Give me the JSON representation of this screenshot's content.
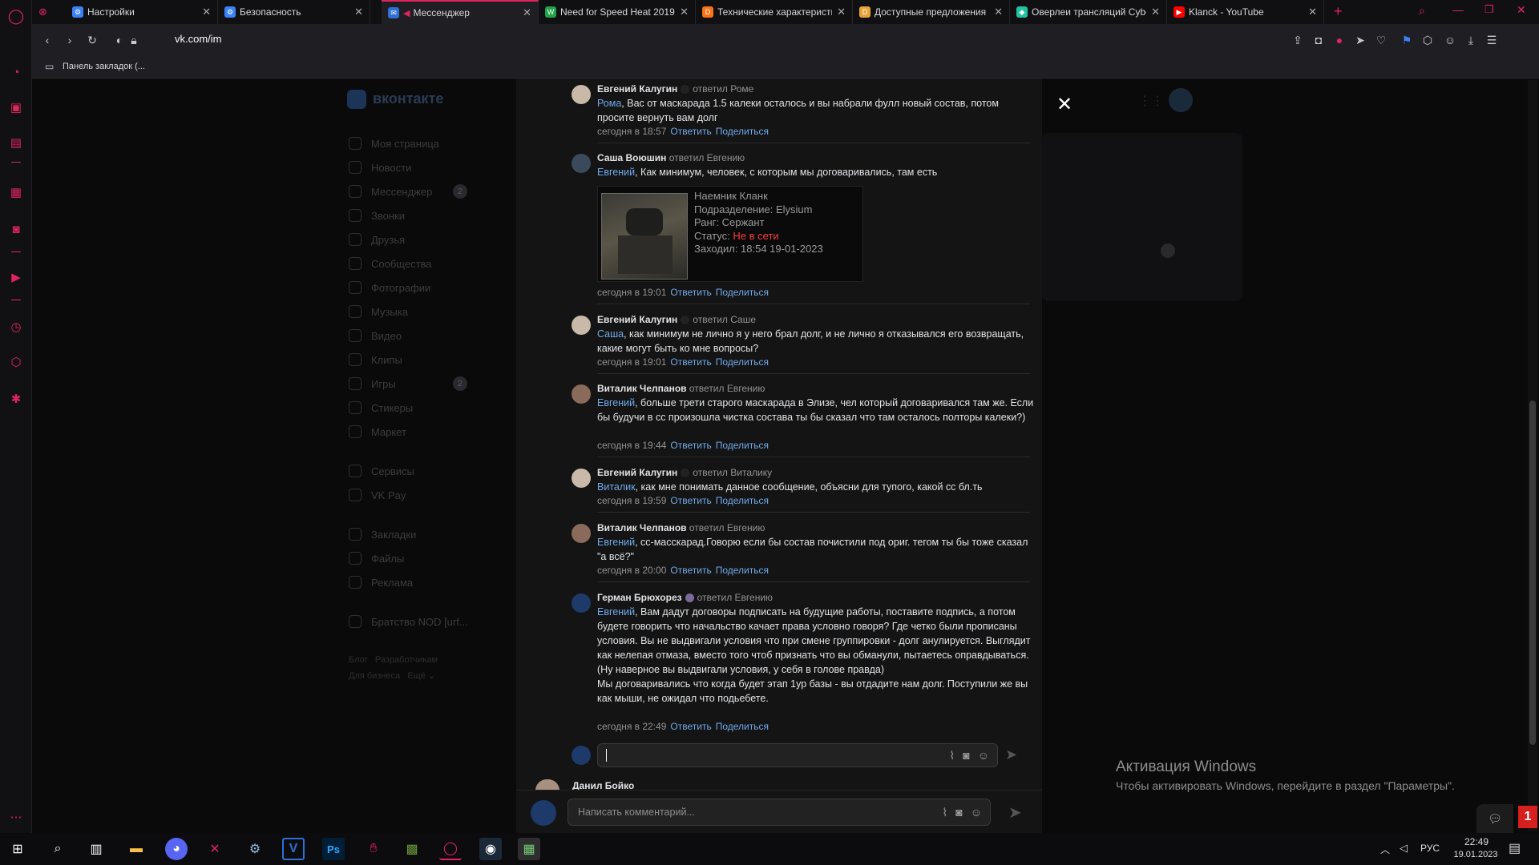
{
  "browser": {
    "tabs": [
      {
        "title": "Настройки",
        "icon_color": "#3b82f6",
        "active": false
      },
      {
        "title": "Безопасность",
        "icon_color": "#3b82f6",
        "active": false
      },
      {
        "title": "Мессенджер",
        "icon_color": "#2f6fd6",
        "active": true
      },
      {
        "title": "Need for Speed Heat 2019",
        "icon_color": "#22a34a",
        "active": false
      },
      {
        "title": "Технические характеристи",
        "icon_color": "#f97316",
        "active": false
      },
      {
        "title": "Доступные предложения",
        "icon_color": "#e8a23a",
        "active": false
      },
      {
        "title": "Оверлеи трансляций Cybe",
        "icon_color": "#22c3a0",
        "active": false
      },
      {
        "title": "Klanck - YouTube",
        "icon_color": "#ff0000",
        "active": false
      }
    ],
    "url": "vk.com/im",
    "bookmark_folder": "Панель закладок (..."
  },
  "vk": {
    "logo": "вконтакте",
    "menu": [
      {
        "label": "Моя страница",
        "count": ""
      },
      {
        "label": "Новости",
        "count": ""
      },
      {
        "label": "Мессенджер",
        "count": "2"
      },
      {
        "label": "Звонки",
        "count": ""
      },
      {
        "label": "Друзья",
        "count": ""
      },
      {
        "label": "Сообщества",
        "count": ""
      },
      {
        "label": "Фотографии",
        "count": ""
      },
      {
        "label": "Музыка",
        "count": ""
      },
      {
        "label": "Видео",
        "count": ""
      },
      {
        "label": "Клипы",
        "count": ""
      },
      {
        "label": "Игры",
        "count": "2"
      },
      {
        "label": "Стикеры",
        "count": ""
      },
      {
        "label": "Маркет",
        "count": ""
      }
    ],
    "menu2": [
      {
        "label": "Сервисы"
      },
      {
        "label": "VK Pay"
      }
    ],
    "menu3": [
      {
        "label": "Закладки"
      },
      {
        "label": "Файлы"
      },
      {
        "label": "Реклама"
      }
    ],
    "community": "Братство NOD [urf...",
    "footer1": "Блог   Разработчикам",
    "footer2": "Для бизнеса   Ещё ⌄"
  },
  "comments": [
    {
      "author": "Евгений Калугин",
      "replied": "ответил Роме",
      "mention": "Рома",
      "text": ", Вас от маскарада 1.5 калеки осталось и вы набрали фулл новый состав, потом просите вернуть вам долг",
      "time": "сегодня в 18:57"
    },
    {
      "author": "Саша Воюшин",
      "replied": "ответил Евгению",
      "mention": "Евгений",
      "text": ", Как минимум, человек, с которым мы договаривались, там есть",
      "time": "сегодня в 19:01"
    },
    {
      "author": "Евгений Калугин",
      "replied": "ответил Саше",
      "mention": "Саша",
      "text": ", как минимум не лично я у него брал долг, и не лично я отказывался его возвращать, какие могут быть ко мне вопросы?",
      "time": "сегодня в 19:01"
    },
    {
      "author": "Виталик Челпанов",
      "replied": "ответил Евгению",
      "mention": "Евгений",
      "text": ", больше трети старого маскарада в Элизе, чел который договаривался там же. Если бы будучи в сс произошла чистка состава ты бы сказал что там осталось полторы калеки?)",
      "time": "сегодня в 19:44"
    },
    {
      "author": "Евгений Калугин",
      "replied": "ответил Виталику",
      "mention": "Виталик",
      "text": ", как мне понимать данное сообщение, объясни для тупого, какой сс бл.ть",
      "time": "сегодня в 19:59"
    },
    {
      "author": "Виталик Челпанов",
      "replied": "ответил Евгению",
      "mention": "Евгений",
      "text": ", сс-масскарад.Говорю если бы состав почистили под ориг. тегом ты бы тоже сказал \"а всё?\"",
      "time": "сегодня в 20:00"
    },
    {
      "author": "Герман Брюхорез",
      "replied": "ответил Евгению",
      "mention": "Евгений",
      "text": ", Вам дадут договоры подписать на будущие работы, поставите подпись, а потом будете говорить что начальство качает права условно говоря? Где четко были прописаны условия. Вы не выдвигали условия что при смене группировки - долг анулируется. Выглядит как нелепая отмаза, вместо того чтоб признать что вы обманули, пытаетесь оправдываться.\n(Ну наверное вы выдвигали условия, у себя в голове правда)\nМы договаривались что когда будет этап 1ур базы - вы отдадите нам долг. Поступили же вы как мыши, не ожидал что подьебете.",
      "time": "сегодня в 22:49"
    }
  ],
  "actions": {
    "reply": "Ответить",
    "share": "Поделиться"
  },
  "card": {
    "name": "Наемник Кланк",
    "division": "Подразделение: Elysium",
    "rank": "Ранг: Сержант",
    "status_label": "Статус:",
    "status_value": "Не в сети",
    "status_color": "#ff3b3b",
    "last_seen": "Заходил: 18:54 19-01-2023"
  },
  "next_author": "Данил Бойко",
  "reply_input": {
    "value": ""
  },
  "comment_input": {
    "placeholder": "Написать комментарий..."
  },
  "close_label": "✕",
  "windows_activation": {
    "title": "Активация Windows",
    "text": "Чтобы активировать Windows, перейдите в раздел \"Параметры\"."
  },
  "taskbar": {
    "time": "22:49",
    "date": "19.01.2023",
    "lang": "РУС",
    "notification_count": "1"
  },
  "colors": {
    "accent": "#e0245e",
    "link": "#71aaeb",
    "vk_blue": "#2f6fd6"
  }
}
